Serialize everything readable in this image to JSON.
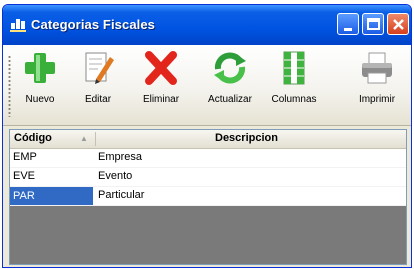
{
  "window": {
    "title": "Categorias Fiscales",
    "min_label": "Minimize",
    "max_label": "Maximize",
    "close_label": "Close"
  },
  "toolbar": {
    "buttons": [
      {
        "label": "Nuevo",
        "icon": "plus-icon",
        "color": "#3ab03a"
      },
      {
        "label": "Editar",
        "icon": "edit-icon",
        "color": "#d07a1a"
      },
      {
        "label": "Eliminar",
        "icon": "delete-x-icon",
        "color": "#e2261b"
      },
      {
        "label": "Actualizar",
        "icon": "refresh-icon",
        "color": "#2e9e3a"
      },
      {
        "label": "Columnas",
        "icon": "columns-icon",
        "color": "#3fb23f"
      },
      {
        "label": "Imprimir",
        "icon": "printer-icon",
        "color": "#707070"
      }
    ]
  },
  "grid": {
    "columns": [
      "Código",
      "Descripcion"
    ],
    "rows": [
      {
        "code": "EMP",
        "description": "Empresa"
      },
      {
        "code": "EVE",
        "description": "Evento"
      },
      {
        "code": "PAR",
        "description": "Particular",
        "selected": true
      }
    ]
  },
  "colors": {
    "titlebar": "#0053e1",
    "selection": "#316ac5",
    "empty_area": "#7a7a7a"
  }
}
